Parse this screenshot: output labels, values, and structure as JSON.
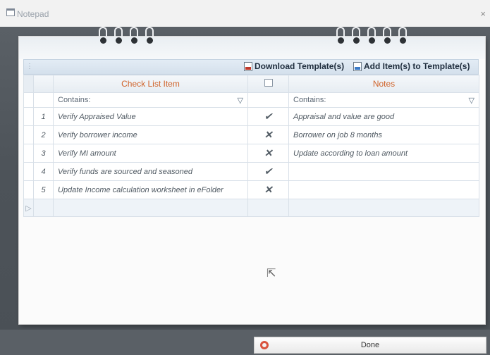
{
  "window": {
    "title": "Notepad",
    "close_glyph": "×"
  },
  "toolbar": {
    "download_label": "Download Template(s)",
    "add_label": "Add Item(s) to Template(s)"
  },
  "grid": {
    "columns": {
      "item": "Check List Item",
      "notes": "Notes"
    },
    "filter": {
      "item": "Contains:",
      "notes": "Contains:"
    },
    "rows": [
      {
        "num": "1",
        "item": "Verify Appraised Value",
        "status": "✔",
        "status_type": "complete",
        "notes": "Appraisal and value are good"
      },
      {
        "num": "2",
        "item": "Verify borrower income",
        "status": "✕",
        "status_type": "incomplete",
        "notes": "Borrower on job 8 months"
      },
      {
        "num": "3",
        "item": "Verify MI amount",
        "status": "✕",
        "status_type": "incomplete",
        "notes": "Update according to loan amount"
      },
      {
        "num": "4",
        "item": "Verify funds are sourced and seasoned",
        "status": "✔",
        "status_type": "complete",
        "notes": ""
      },
      {
        "num": "5",
        "item": "Update Income calculation worksheet in eFolder",
        "status": "✕",
        "status_type": "incomplete",
        "notes": ""
      }
    ],
    "new_row_marker": "▷"
  },
  "footer": {
    "done_label": "Done"
  },
  "colors": {
    "header_text": "#d0632a",
    "check": "#7cb342",
    "cross": "#d32f2f"
  }
}
